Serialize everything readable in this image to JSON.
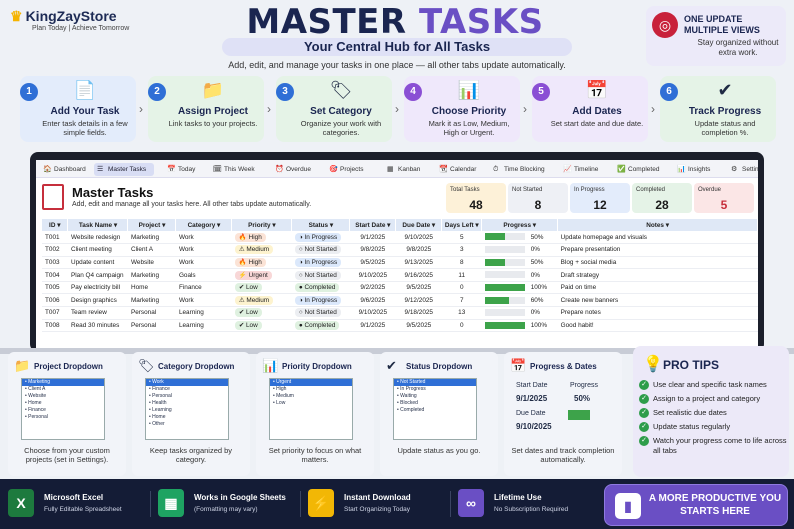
{
  "brand": {
    "name": "KingZayStore",
    "tagline": "Plan Today  |  Achieve Tomorrow"
  },
  "title": {
    "part1": "MASTER",
    "part2": "TASKS"
  },
  "subtitle": "Your Central Hub for All Tasks",
  "tagline": "Add, edit, and manage your tasks in one place — all other tabs update automatically.",
  "update_box": {
    "title": "ONE UPDATE MULTIPLE VIEWS",
    "sub": "Stay organized without extra work."
  },
  "steps": [
    {
      "num": "1",
      "title": "Add Your Task",
      "desc": "Enter task details in a few simple fields.",
      "color": "#2f6fd6",
      "bg": "#e3ecfb"
    },
    {
      "num": "2",
      "title": "Assign Project",
      "desc": "Link tasks to your projects.",
      "color": "#2f6fd6",
      "bg": "#e5f3e7"
    },
    {
      "num": "3",
      "title": "Set Category",
      "desc": "Organize your work with categories.",
      "color": "#2f6fd6",
      "bg": "#e5f3e7"
    },
    {
      "num": "4",
      "title": "Choose Priority",
      "desc": "Mark it as Low, Medium, High or Urgent.",
      "color": "#8a4fd4",
      "bg": "#efe8fb"
    },
    {
      "num": "5",
      "title": "Add Dates",
      "desc": "Set start date and due date.",
      "color": "#8a4fd4",
      "bg": "#efe8fb"
    },
    {
      "num": "6",
      "title": "Track Progress",
      "desc": "Update status and completion %.",
      "color": "#2f6fd6",
      "bg": "#e5f3e7"
    }
  ],
  "tabs": [
    "Dashboard",
    "Master Tasks",
    "Today",
    "This Week",
    "Overdue",
    "Projects",
    "Kanban",
    "Calendar",
    "Time Blocking",
    "Timeline",
    "Completed",
    "Insights",
    "Settings"
  ],
  "sheet": {
    "title": "Master Tasks",
    "sub": "Add, edit and manage all your tasks here. All other tabs update automatically."
  },
  "stats": [
    {
      "label": "Total Tasks",
      "value": "48",
      "color": "#1a1a1a",
      "bg": "#fdf1d8"
    },
    {
      "label": "Not Started",
      "value": "8",
      "color": "#1a1a1a",
      "bg": "#eef0f5"
    },
    {
      "label": "In Progress",
      "value": "12",
      "color": "#1a1a1a",
      "bg": "#e3ecfb"
    },
    {
      "label": "Completed",
      "value": "28",
      "color": "#1a1a1a",
      "bg": "#e5f3e7"
    },
    {
      "label": "Overdue",
      "value": "5",
      "color": "#c62f3c",
      "bg": "#fbe6e6"
    }
  ],
  "columns": [
    "ID",
    "Task Name",
    "Project",
    "Category",
    "Priority",
    "Status",
    "Start Date",
    "Due Date",
    "Days Left",
    "Progress",
    "Notes"
  ],
  "rows": [
    {
      "id": "T001",
      "task": "Website redesign",
      "project": "Marketing",
      "category": "Work",
      "priority": "High",
      "status": "In Progress",
      "start": "9/1/2025",
      "due": "9/10/2025",
      "days": "5",
      "progress": "50%",
      "pv": 0.5,
      "notes": "Update homepage and visuals"
    },
    {
      "id": "T002",
      "task": "Client meeting",
      "project": "Client A",
      "category": "Work",
      "priority": "Medium",
      "status": "Not Started",
      "start": "9/8/2025",
      "due": "9/8/2025",
      "days": "3",
      "progress": "0%",
      "pv": 0,
      "notes": "Prepare presentation"
    },
    {
      "id": "T003",
      "task": "Update content",
      "project": "Website",
      "category": "Work",
      "priority": "High",
      "status": "In Progress",
      "start": "9/5/2025",
      "due": "9/13/2025",
      "days": "8",
      "progress": "50%",
      "pv": 0.5,
      "notes": "Blog + social media"
    },
    {
      "id": "T004",
      "task": "Plan Q4 campaign",
      "project": "Marketing",
      "category": "Goals",
      "priority": "Urgent",
      "status": "Not Started",
      "start": "9/10/2025",
      "due": "9/16/2025",
      "days": "11",
      "progress": "0%",
      "pv": 0,
      "notes": "Draft strategy"
    },
    {
      "id": "T005",
      "task": "Pay electricity bill",
      "project": "Home",
      "category": "Finance",
      "priority": "Low",
      "status": "Completed",
      "start": "9/2/2025",
      "due": "9/5/2025",
      "days": "0",
      "progress": "100%",
      "pv": 1,
      "notes": "Paid on time"
    },
    {
      "id": "T006",
      "task": "Design graphics",
      "project": "Marketing",
      "category": "Work",
      "priority": "Medium",
      "status": "In Progress",
      "start": "9/6/2025",
      "due": "9/12/2025",
      "days": "7",
      "progress": "60%",
      "pv": 0.6,
      "notes": "Create new banners"
    },
    {
      "id": "T007",
      "task": "Team review",
      "project": "Personal",
      "category": "Learning",
      "priority": "Low",
      "status": "Not Started",
      "start": "9/10/2025",
      "due": "9/18/2025",
      "days": "13",
      "progress": "0%",
      "pv": 0,
      "notes": "Prepare notes"
    },
    {
      "id": "T008",
      "task": "Read 30 minutes",
      "project": "Personal",
      "category": "Learning",
      "priority": "Low",
      "status": "Completed",
      "start": "9/1/2025",
      "due": "9/5/2025",
      "days": "0",
      "progress": "100%",
      "pv": 1,
      "notes": "Good habit!"
    }
  ],
  "priority_colors": {
    "High": "#fbe3d6",
    "Medium": "#fdf3cf",
    "Urgent": "#f8d7d7",
    "Low": "#dff1e0"
  },
  "status_colors": {
    "In Progress": "#dbe8fb",
    "Not Started": "#eceef2",
    "Completed": "#dff1e0"
  },
  "panels": [
    {
      "title": "Project Dropdown",
      "desc": "Choose from your custom projects (set in Settings).",
      "items": [
        "Marketing",
        "Client A",
        "Website",
        "Home",
        "Finance",
        "Personal"
      ],
      "sel": 0
    },
    {
      "title": "Category Dropdown",
      "desc": "Keep tasks organized by category.",
      "items": [
        "Work",
        "Finance",
        "Personal",
        "Health",
        "Learning",
        "Home",
        "Other"
      ],
      "sel": 0
    },
    {
      "title": "Priority Dropdown",
      "desc": "Set priority to focus on what matters.",
      "items": [
        "Urgent",
        "High",
        "Medium",
        "Low"
      ],
      "sel": 0
    },
    {
      "title": "Status Dropdown",
      "desc": "Update status as you go.",
      "items": [
        "Not Started",
        "In Progress",
        "Waiting",
        "Blocked",
        "Completed"
      ],
      "sel": 0
    },
    {
      "title": "Progress & Dates",
      "desc": "Set dates and track completion automatically."
    }
  ],
  "progress_panel": {
    "start_label": "Start Date",
    "start": "9/1/2025",
    "due_label": "Due Date",
    "due": "9/10/2025",
    "progress_label": "Progress",
    "progress": "50%"
  },
  "tips": {
    "title": "PRO TIPS",
    "items": [
      "Use clear and specific task names",
      "Assign to a project and category",
      "Set realistic due dates",
      "Update status regularly",
      "Watch your progress come to life across all tabs"
    ]
  },
  "footer": [
    {
      "title": "Microsoft Excel",
      "sub": "Fully Editable Spreadsheet"
    },
    {
      "title": "Works in Google Sheets",
      "sub": "(Formatting may vary)"
    },
    {
      "title": "Instant Download",
      "sub": "Start Organizing Today"
    },
    {
      "title": "Lifetime Use",
      "sub": "No Subscription Required"
    }
  ],
  "cta": "A MORE PRODUCTIVE YOU STARTS HERE"
}
